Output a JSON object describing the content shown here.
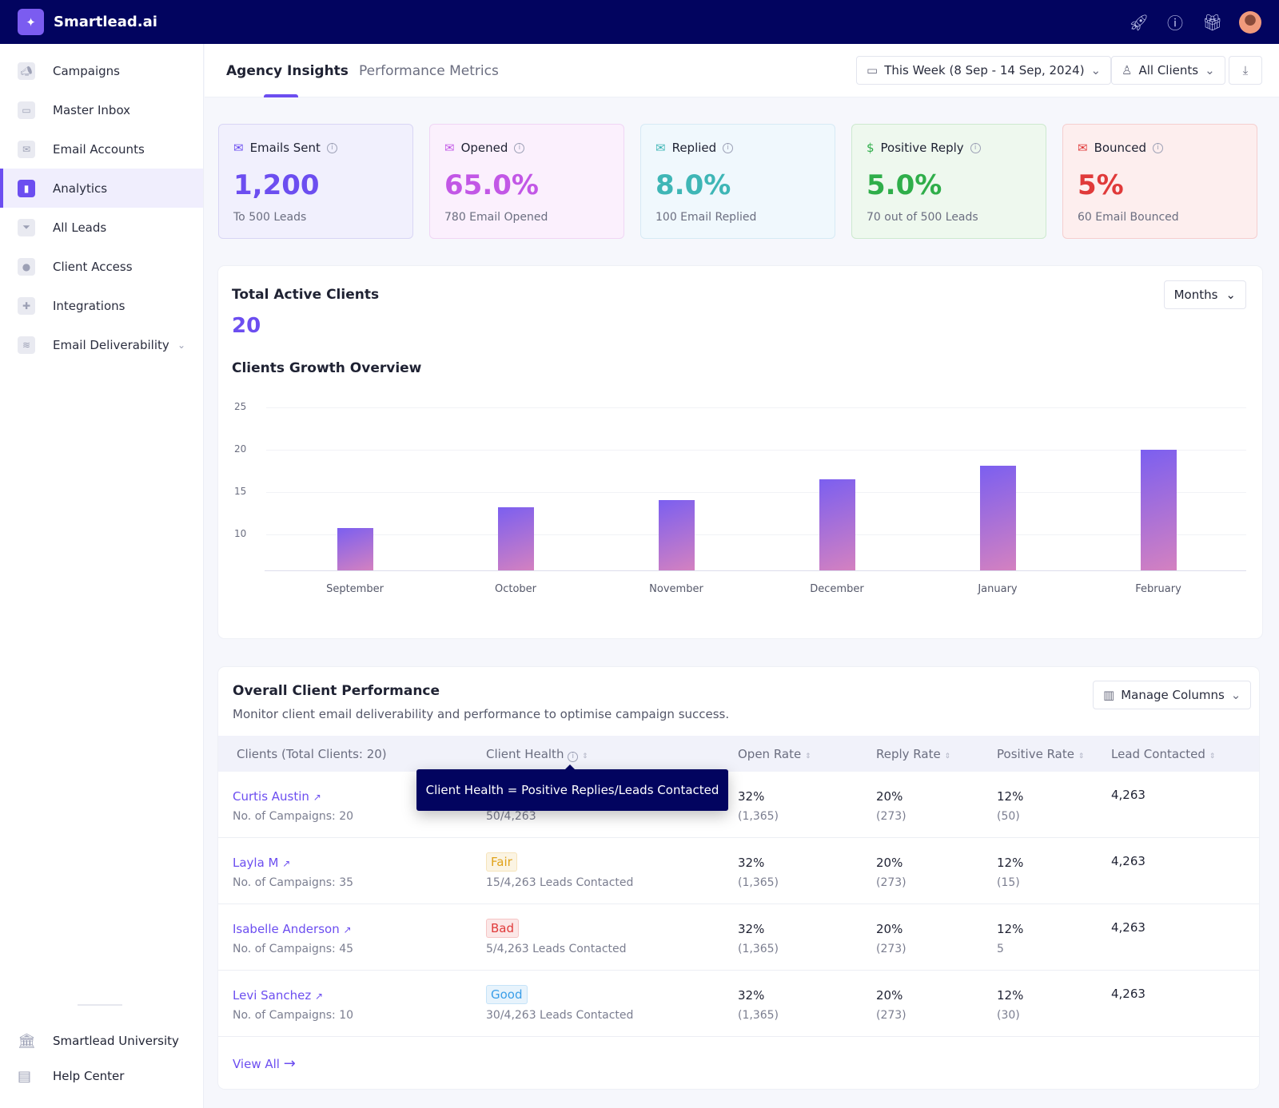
{
  "app": {
    "brand": "Smartlead.ai",
    "top_icons": [
      "rocket-icon",
      "help-icon",
      "gift-icon",
      "avatar"
    ]
  },
  "sidebar": {
    "items": [
      {
        "label": "Campaigns",
        "icon": "megaphone-icon"
      },
      {
        "label": "Master Inbox",
        "icon": "inbox-icon"
      },
      {
        "label": "Email Accounts",
        "icon": "mail-icon"
      },
      {
        "label": "Analytics",
        "icon": "bar-chart-icon",
        "active": true
      },
      {
        "label": "All Leads",
        "icon": "funnel-icon"
      },
      {
        "label": "Client Access",
        "icon": "user-icon"
      },
      {
        "label": "Integrations",
        "icon": "puzzle-icon"
      },
      {
        "label": "Email Deliverability",
        "icon": "layers-icon",
        "expandable": true
      }
    ],
    "bottom": [
      {
        "label": "Smartlead University",
        "icon": "bank-icon"
      },
      {
        "label": "Help Center",
        "icon": "book-icon"
      }
    ]
  },
  "tabs": [
    {
      "label": "Agency Insights",
      "active": true
    },
    {
      "label": "Performance Metrics"
    }
  ],
  "filters": {
    "date": "This Week (8 Sep - 14 Sep, 2024)",
    "clients": "All Clients",
    "download_icon": "download-icon"
  },
  "stats": [
    {
      "label": "Emails Sent",
      "value": "1,200",
      "sub": "To 500 Leads",
      "color": "#6c4ef0",
      "bg": "#f1f0fd",
      "border": "#d9d6f5"
    },
    {
      "label": "Opened",
      "value": "65.0%",
      "sub": "780 Email Opened",
      "color": "#c257e6",
      "bg": "#fbf0fd",
      "border": "#f0d6f5"
    },
    {
      "label": "Replied",
      "value": "8.0%",
      "sub": "100 Email Replied",
      "color": "#3fb6b6",
      "bg": "#f0f8fd",
      "border": "#d6eaf5"
    },
    {
      "label": "Positive Reply",
      "value": "5.0%",
      "sub": "70 out of 500 Leads",
      "color": "#2fae4a",
      "bg": "#eef8ee",
      "border": "#cde9cf"
    },
    {
      "label": "Bounced",
      "value": "5%",
      "sub": "60 Email Bounced",
      "color": "#e03a3a",
      "bg": "#fdeeee",
      "border": "#f5cfcf"
    }
  ],
  "clients_panel": {
    "title": "Total Active Clients",
    "count": "20",
    "period": "Months",
    "chart_title": "Clients Growth Overview"
  },
  "chart_data": {
    "type": "bar",
    "title": "Clients Growth Overview",
    "categories": [
      "September",
      "October",
      "November",
      "December",
      "January",
      "February"
    ],
    "values": [
      10.8,
      13.2,
      14.1,
      16.5,
      18.1,
      20
    ],
    "yticks": [
      10,
      15,
      20,
      25
    ],
    "ylim": [
      5.8,
      25
    ],
    "grid": true,
    "xlabel": "",
    "ylabel": "",
    "bar_gradient": [
      "#7b5ff0",
      "#d481c0"
    ]
  },
  "performance": {
    "title": "Overall Client Performance",
    "subtitle": "Monitor client email deliverability and performance to optimise campaign success.",
    "manage_columns": "Manage Columns",
    "columns": [
      "Clients (Total Clients: 20)",
      "Client Health",
      "Open Rate",
      "Reply Rate",
      "Positive Rate",
      "Lead Contacted"
    ],
    "tooltip": "Client Health = Positive Replies/Leads Contacted",
    "rows": [
      {
        "name": "Curtis Austin",
        "campaigns": "No. of Campaigns: 20",
        "health": "",
        "health_color": "",
        "health_text": "50/4,263",
        "open": "32%",
        "open_sub": "(1,365)",
        "reply": "20%",
        "reply_sub": "(273)",
        "positive": "12%",
        "positive_sub": "(50)",
        "leads": "4,263"
      },
      {
        "name": "Layla M",
        "campaigns": "No. of Campaigns: 35",
        "health": "Fair",
        "health_color": "#e0a21a",
        "health_text": "15/4,263 Leads Contacted",
        "open": "32%",
        "open_sub": "(1,365)",
        "reply": "20%",
        "reply_sub": "(273)",
        "positive": "12%",
        "positive_sub": "(15)",
        "leads": "4,263"
      },
      {
        "name": "Isabelle Anderson",
        "campaigns": "No. of Campaigns: 45",
        "health": "Bad",
        "health_color": "#e03a3a",
        "health_text": "5/4,263 Leads Contacted",
        "open": "32%",
        "open_sub": "(1,365)",
        "reply": "20%",
        "reply_sub": "(273)",
        "positive": "12%",
        "positive_sub": "5",
        "leads": "4,263"
      },
      {
        "name": "Levi Sanchez",
        "campaigns": "No. of Campaigns: 10",
        "health": "Good",
        "health_color": "#3a9ee8",
        "health_text": "30/4,263 Leads Contacted",
        "open": "32%",
        "open_sub": "(1,365)",
        "reply": "20%",
        "reply_sub": "(273)",
        "positive": "12%",
        "positive_sub": "(30)",
        "leads": "4,263"
      }
    ],
    "view_all": "View All"
  }
}
